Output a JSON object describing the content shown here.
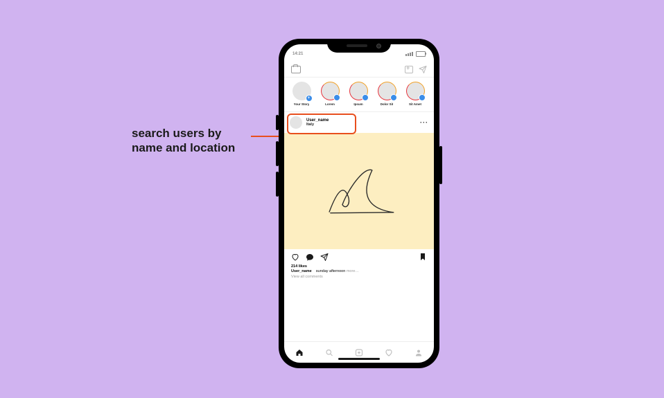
{
  "annotation": {
    "text1": "search users by",
    "text2": "name and location"
  },
  "statusbar": {
    "time": "14:21"
  },
  "stories": [
    {
      "label": "Your Story",
      "ring": false,
      "badge": "+"
    },
    {
      "label": "Lorem",
      "ring": true,
      "badge": ""
    },
    {
      "label": "Ipsum",
      "ring": true,
      "badge": ""
    },
    {
      "label": "Dolor Sit",
      "ring": true,
      "badge": ""
    },
    {
      "label": "Sit Amet",
      "ring": true,
      "badge": ""
    }
  ],
  "post": {
    "header": {
      "username": "User_name",
      "location": "Italy",
      "more": "···"
    },
    "likes_line": "214 likes",
    "caption_user": "User_name",
    "caption_text": "sunday afternoon",
    "caption_more": "more…",
    "view_all": "View all comments"
  }
}
